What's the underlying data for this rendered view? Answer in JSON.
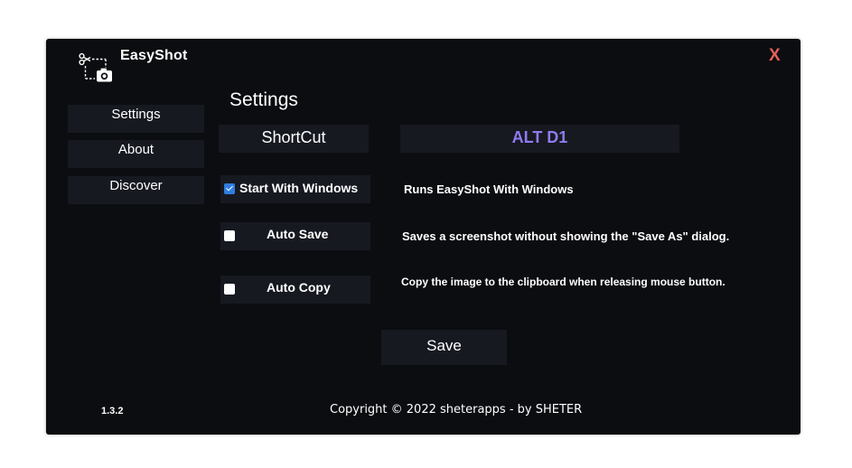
{
  "app": {
    "title": "EasyShot",
    "close_label": "X"
  },
  "sidebar": {
    "items": [
      {
        "label": "Settings"
      },
      {
        "label": "About"
      },
      {
        "label": "Discover"
      }
    ]
  },
  "main": {
    "section_title": "Settings",
    "shortcut_label": "ShortCut",
    "shortcut_value": "ALT D1",
    "options": [
      {
        "label": "Start With Windows",
        "checked": true,
        "description": "Runs EasyShot With Windows"
      },
      {
        "label": "Auto Save",
        "checked": false,
        "description": "Saves a screenshot without showing the \"Save As\" dialog."
      },
      {
        "label": "Auto Copy",
        "checked": false,
        "description": "Copy the image to the clipboard when releasing mouse button."
      }
    ],
    "save_label": "Save"
  },
  "footer": {
    "version": "1.3.2",
    "copyright": "Copyright © 2022 sheterapps - by SHETER"
  },
  "colors": {
    "background": "#0c0d11",
    "panel": "#171921",
    "accent": "#8f7bf0",
    "close": "#e4605a",
    "checkbox": "#2f7ee0"
  },
  "icons": {
    "logo": "scissors-camera-icon",
    "close": "close-icon"
  }
}
